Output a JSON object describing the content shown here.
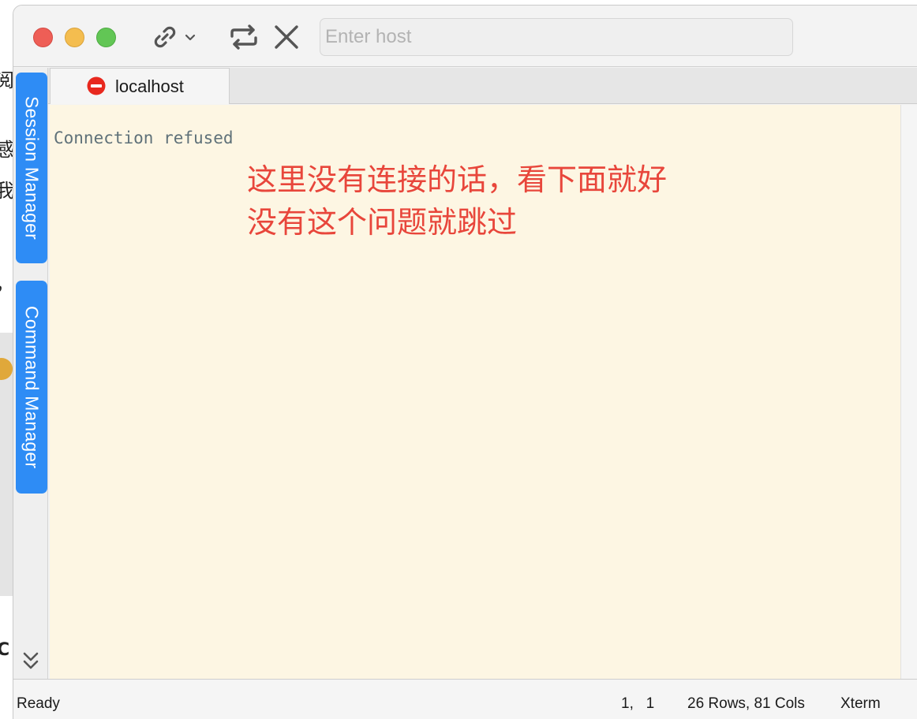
{
  "background_app": {
    "glyphs": [
      "阅",
      "感",
      "我",
      "，",
      "C"
    ]
  },
  "toolbar": {
    "connect_icon": "link-icon",
    "dropdown_icon": "chevron-down-icon",
    "reconnect_icon": "repeat-icon",
    "disconnect_icon": "close-icon",
    "host_placeholder": "Enter host",
    "host_value": ""
  },
  "sidebar": {
    "session_manager_label": "Session Manager",
    "command_manager_label": "Command Manager",
    "expand_icon": "double-chevron-down-icon"
  },
  "tabs": [
    {
      "label": "localhost",
      "status_icon": "no-entry-icon",
      "status_color": "#e8281e"
    }
  ],
  "terminal": {
    "output_line": "Connection refused",
    "background_color": "#fdf6e3",
    "annotation_lines": [
      "这里没有连接的话，看下面就好",
      "没有这个问题就跳过"
    ],
    "annotation_color": "#e8463b"
  },
  "statusbar": {
    "state": "Ready",
    "cursor_position": "1,   1",
    "dimensions": "26 Rows, 81 Cols",
    "terminal_type": "Xterm"
  },
  "colors": {
    "accent": "#2e8cf5",
    "close": "#ee5e56",
    "minimize": "#f4bd4f",
    "zoom": "#62c655"
  }
}
